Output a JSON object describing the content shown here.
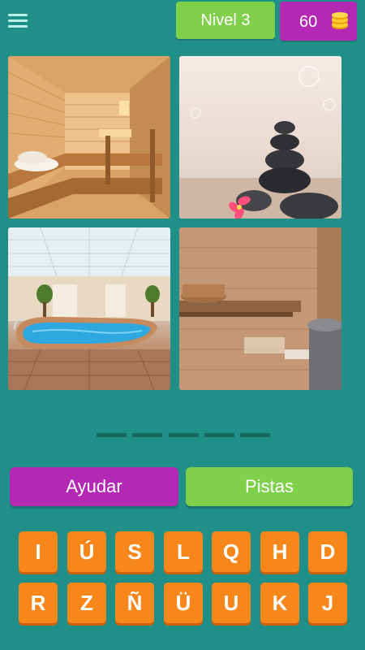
{
  "header": {
    "level_label": "Nivel 3",
    "coins": "60",
    "menu_icon": "hamburger-menu-icon",
    "coin_icon": "coin-stack-icon"
  },
  "images": [
    {
      "name": "sauna-interior-photo"
    },
    {
      "name": "zen-stones-photo"
    },
    {
      "name": "indoor-pool-photo"
    },
    {
      "name": "wooden-sauna-photo"
    }
  ],
  "answer": {
    "slots": 5
  },
  "actions": {
    "help_label": "Ayudar",
    "hints_label": "Pistas"
  },
  "keyboard": {
    "row1": [
      "I",
      "Ú",
      "S",
      "L",
      "Q",
      "H",
      "D"
    ],
    "row2": [
      "R",
      "Z",
      "Ñ",
      "Ü",
      "U",
      "K",
      "J"
    ]
  },
  "colors": {
    "background": "#1f8f88",
    "green": "#7fd14b",
    "purple": "#b329b3",
    "orange": "#f7861b"
  }
}
